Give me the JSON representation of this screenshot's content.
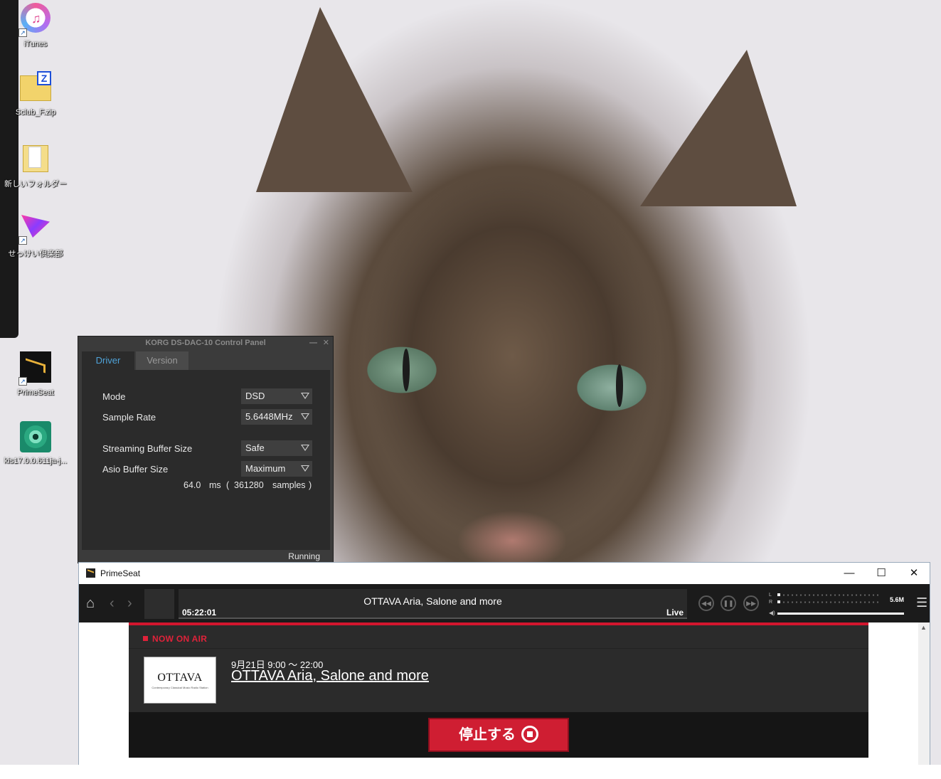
{
  "desktop": {
    "icons": [
      {
        "label": "iTunes"
      },
      {
        "label": "Sclub_F.zip"
      },
      {
        "label": "新しいフォルダー"
      },
      {
        "label": "せっけい倶楽部"
      },
      {
        "label": "PrimeSeat"
      },
      {
        "label": "kis17.0.0.611ja-j..."
      }
    ]
  },
  "korg": {
    "title": "KORG DS-DAC-10 Control Panel",
    "tabs": [
      "Driver",
      "Version"
    ],
    "active_tab": "Driver",
    "fields": [
      {
        "label": "Mode",
        "value": "DSD"
      },
      {
        "label": "Sample Rate",
        "value": "5.6448MHz"
      },
      {
        "label": "Streaming Buffer Size",
        "value": "Safe"
      },
      {
        "label": "Asio Buffer Size",
        "value": "Maximum"
      }
    ],
    "buffer": {
      "ms": "64.0",
      "ms_unit": "ms",
      "open": "(",
      "samples": "361280",
      "samples_unit": "samples",
      "close": ")"
    },
    "status": "Running"
  },
  "primeseat": {
    "window_title": "PrimeSeat",
    "window_buttons": {
      "minimize": "—",
      "maximize": "☐",
      "close": "✕"
    },
    "player": {
      "track_title": "OTTAVA Aria, Salone and more",
      "elapsed": "05:22:01",
      "live": "Live",
      "meter_l": "L",
      "meter_r": "R",
      "sample_rate": "5.6M"
    },
    "on_air": {
      "label": "NOW ON AIR",
      "logo_text": "OTTAVA",
      "logo_sub": "Contemporary Classical Music Radio Station",
      "time": "9月21日 9:00 ～ 22:00",
      "title": "OTTAVA Aria, Salone and more",
      "stop_label": "停止する"
    }
  },
  "colors": {
    "accent_red": "#d2162e",
    "korg_tab_active": "#4fa3d9"
  }
}
